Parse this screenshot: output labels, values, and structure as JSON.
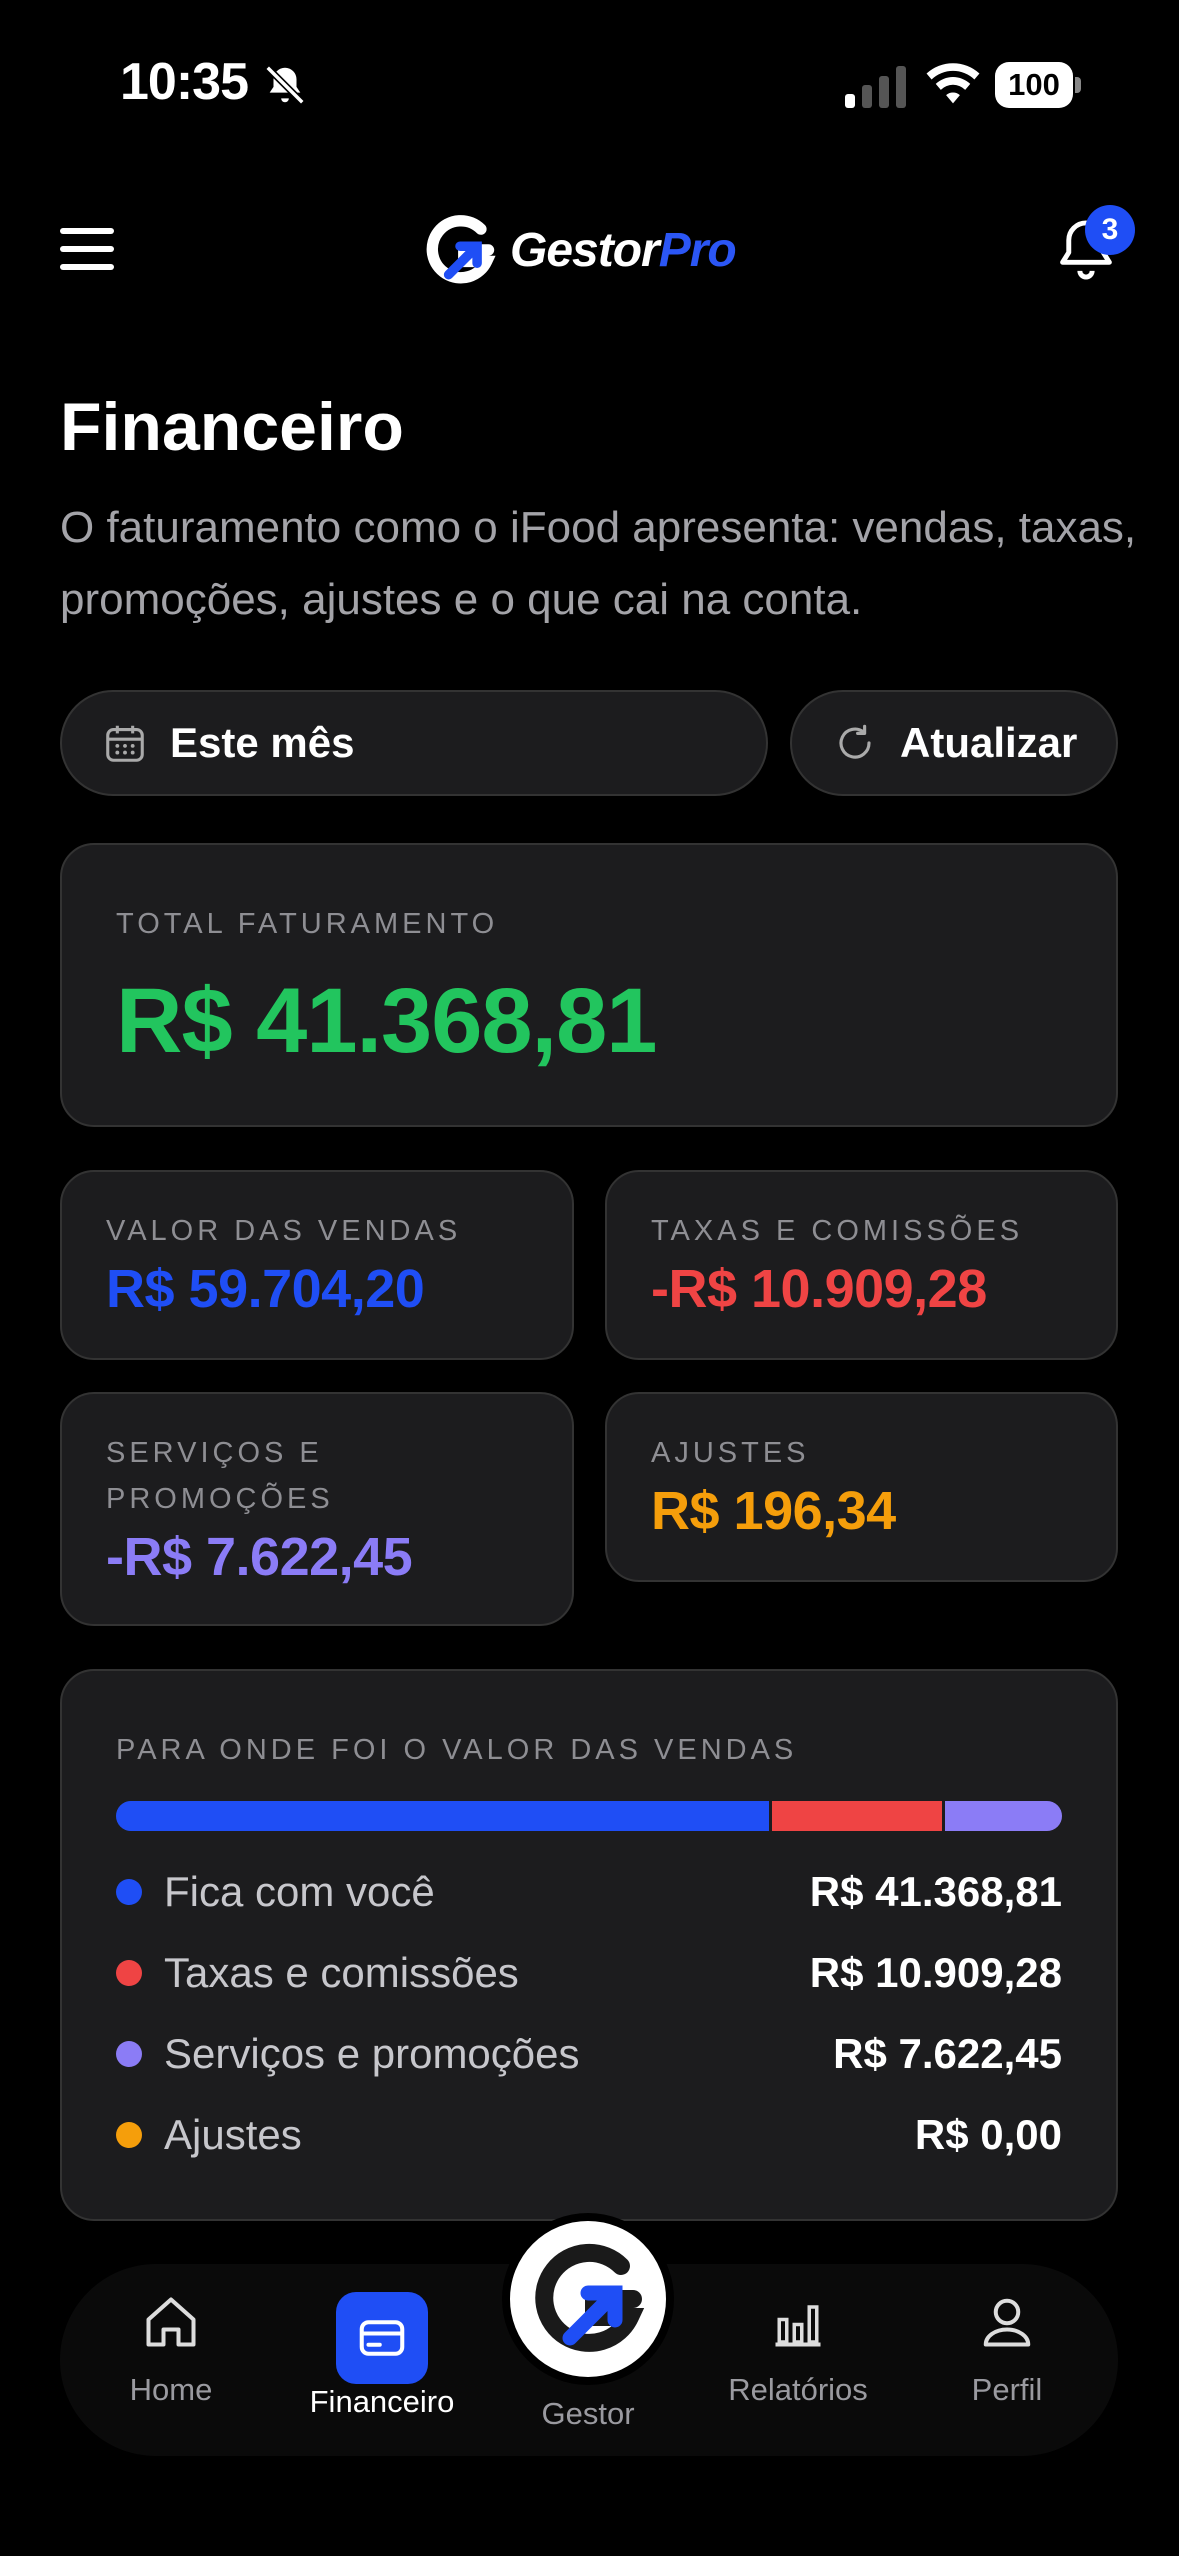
{
  "status_bar": {
    "time": "10:35",
    "battery": "100"
  },
  "header": {
    "logo_primary": "Gestor",
    "logo_accent": "Pro",
    "notification_count": "3"
  },
  "page": {
    "title": "Financeiro",
    "subtitle": "O faturamento como o iFood apresenta: vendas, taxas, promoções, ajustes e o que cai na conta."
  },
  "filters": {
    "period_label": "Este mês",
    "refresh_label": "Atualizar"
  },
  "summary": {
    "total_label": "TOTAL FATURAMENTO",
    "total_value": "R$ 41.368,81",
    "sales_label": "VALOR DAS VENDAS",
    "sales_value": "R$ 59.704,20",
    "fees_label": "TAXAS E COMISSÕES",
    "fees_value": "-R$ 10.909,28",
    "services_label": "SERVIÇOS E PROMOÇÕES",
    "services_value": "-R$ 7.622,45",
    "adjust_label": "AJUSTES",
    "adjust_value": "R$ 196,34"
  },
  "breakdown": {
    "title": "PARA ONDE FOI O VALOR DAS VENDAS",
    "items": [
      {
        "label": "Fica com você",
        "value": "R$ 41.368,81",
        "amount": 41368.81,
        "color": "#1f4ef5"
      },
      {
        "label": "Taxas e comissões",
        "value": "R$ 10.909,28",
        "amount": 10909.28,
        "color": "#ef4444"
      },
      {
        "label": "Serviços e promoções",
        "value": "R$ 7.622,45",
        "amount": 7622.45,
        "color": "#8b7cf6"
      },
      {
        "label": "Ajustes",
        "value": "R$ 0,00",
        "amount": 0,
        "color": "#f59e0b"
      }
    ]
  },
  "colors": {
    "accent": "#1f4ef5",
    "positive": "#22c55e",
    "negative": "#ef4444",
    "purple": "#8b7cf6",
    "orange": "#f59e0b"
  },
  "nav": {
    "home": "Home",
    "financeiro": "Financeiro",
    "gestor": "Gestor",
    "relatorios": "Relatórios",
    "perfil": "Perfil"
  }
}
